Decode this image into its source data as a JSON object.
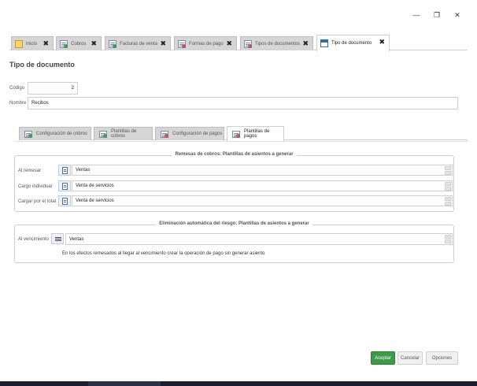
{
  "window": {
    "minimize_glyph": "—",
    "maximize_glyph": "❐",
    "close_glyph": "✕"
  },
  "tabs": [
    {
      "label": "Inicio",
      "icon": "flag-icon",
      "active": false
    },
    {
      "label": "Cobros",
      "icon": "cobros-icon",
      "active": false
    },
    {
      "label": "Facturas de venta",
      "icon": "invoice-icon",
      "active": false
    },
    {
      "label": "Formas de pago",
      "icon": "payment-icon",
      "active": false
    },
    {
      "label": "Tipos de documentos",
      "icon": "document-types-icon",
      "active": false
    },
    {
      "label": "Tipo de documento",
      "icon": "calendar-icon",
      "active": true
    }
  ],
  "tab_close_glyph": "✖",
  "page_title": "Tipo de documento",
  "form": {
    "codigo_label": "Código",
    "codigo_value": "2",
    "nombre_label": "Nombre",
    "nombre_value": "Recibos"
  },
  "subtabs": [
    {
      "label": "Configuración de cobros",
      "active": false
    },
    {
      "label": "Plantillas de cobros",
      "active": false
    },
    {
      "label": "Configuración de pagos",
      "active": false
    },
    {
      "label": "Plantillas de pagos",
      "active": true
    }
  ],
  "remesas": {
    "legend": "Remesas de cobros: Plantillas de asientos a generar",
    "rows": [
      {
        "label": "Al remesar",
        "value": "Ventas"
      },
      {
        "label": "Cargo individual",
        "value": "Venta de servicios"
      },
      {
        "label": "Cargar por el total",
        "value": "Venta de servicios"
      }
    ]
  },
  "riesgo": {
    "legend": "Eliminación automática del riesgo: Plantillas de asientos a generar",
    "row_label": "Al vencimiento",
    "row_value": "Ventas",
    "note": "En los efectos remesados al llegar al vencimiento crear la operación de pago sin generar asiento"
  },
  "buttons": {
    "accept": "Aceptar",
    "cancel": "Cancelar",
    "options": "Opciones"
  },
  "colors": {
    "accept": "#3c9a4a",
    "tab_inactive": "#d6d6d6"
  }
}
